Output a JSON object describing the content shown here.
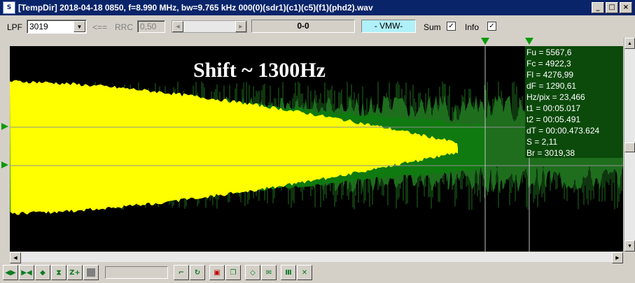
{
  "window": {
    "title": "[TempDir] 2018-04-18 0850, f=8.990 MHz, bw=9.765 kHz 000(0)(sdr1)(c1)(c5)(f1)(phd2).wav",
    "icon_label": "S"
  },
  "toolbar": {
    "lpf_label": "LPF",
    "lpf_value": "3019",
    "arrow_label": "<==",
    "rrc_label": "RRC",
    "rrc_value": "0,50",
    "readout": "0-0",
    "mode_label": "- VMW-",
    "sum_label": "Sum",
    "sum_checked": "✓",
    "info_label": "Info",
    "info_checked": "✓"
  },
  "info": {
    "lines": [
      "Fu = 5567,6",
      "Fc = 4922,3",
      "Fl = 4276,99",
      "dF = 1290,61",
      "Hz/pix = 23,466",
      "t1 = 00:05.017",
      "t2 = 00:05.491",
      "dT = 00:00.473.624",
      "S = 2,11",
      "Br = 3019,38"
    ]
  },
  "annotation": "Shift ~ 1300Hz",
  "colors": {
    "upper_tone": "#ffff00",
    "lower_tone": "#0f7a0f",
    "noise": "#1e6e1e",
    "background": "#000000",
    "marker": "#0a9a0a"
  },
  "icons": [
    "zoom-in-out-icon",
    "zoom-fit-icon",
    "arrows-updown-icon",
    "vertical-zoom-icon",
    "z-plus-icon",
    "stop-icon",
    "corner-icon",
    "loop-icon",
    "save-icon",
    "copy-icon",
    "diamond-icon",
    "envelope-icon",
    "bars-icon",
    "cross-icon"
  ]
}
